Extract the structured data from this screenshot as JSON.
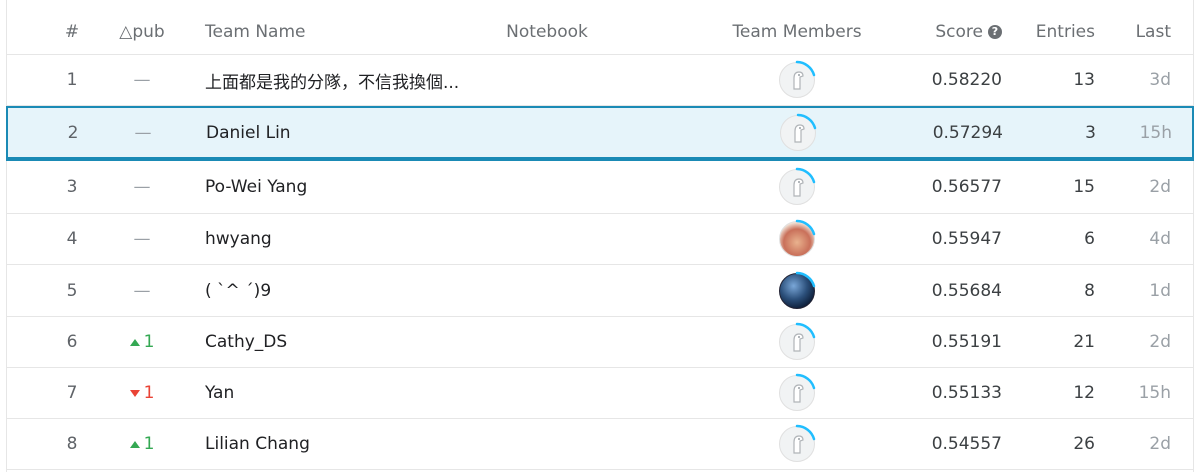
{
  "header": {
    "rank": "#",
    "delta": "△pub",
    "team_name": "Team Name",
    "notebook": "Notebook",
    "team_members": "Team Members",
    "score": "Score",
    "entries": "Entries",
    "last": "Last"
  },
  "rows": [
    {
      "rank": "1",
      "delta": "—",
      "delta_dir": "none",
      "name": "上面都是我的分隊，不信我換個...",
      "avatar_icon": "default-avatar-icon",
      "score": "0.58220",
      "entries": "13",
      "last": "3d"
    },
    {
      "rank": "2",
      "delta": "—",
      "delta_dir": "none",
      "name": "Daniel Lin",
      "avatar_icon": "default-avatar-icon",
      "score": "0.57294",
      "entries": "3",
      "last": "15h",
      "selected": true
    },
    {
      "rank": "3",
      "delta": "—",
      "delta_dir": "none",
      "name": "Po-Wei Yang",
      "avatar_icon": "default-avatar-icon",
      "score": "0.56577",
      "entries": "15",
      "last": "2d"
    },
    {
      "rank": "4",
      "delta": "—",
      "delta_dir": "none",
      "name": "hwyang",
      "avatar_icon": "food-avatar-icon",
      "score": "0.55947",
      "entries": "6",
      "last": "4d"
    },
    {
      "rank": "5",
      "delta": "—",
      "delta_dir": "none",
      "name": "( `^ ´)9",
      "avatar_icon": "night-sky-avatar-icon",
      "score": "0.55684",
      "entries": "8",
      "last": "1d"
    },
    {
      "rank": "6",
      "delta": "1",
      "delta_dir": "up",
      "name": "Cathy_DS",
      "avatar_icon": "default-avatar-icon",
      "score": "0.55191",
      "entries": "21",
      "last": "2d"
    },
    {
      "rank": "7",
      "delta": "1",
      "delta_dir": "down",
      "name": "Yan",
      "avatar_icon": "default-avatar-icon",
      "score": "0.55133",
      "entries": "12",
      "last": "15h"
    },
    {
      "rank": "8",
      "delta": "1",
      "delta_dir": "up",
      "name": "Lilian Chang",
      "avatar_icon": "default-avatar-icon",
      "score": "0.54557",
      "entries": "26",
      "last": "2d"
    }
  ],
  "colors": {
    "selected_border": "#1a8ab5",
    "selected_bg": "#e6f4fa",
    "up": "#34a853",
    "down": "#ea4335",
    "ring": "#20beff"
  }
}
